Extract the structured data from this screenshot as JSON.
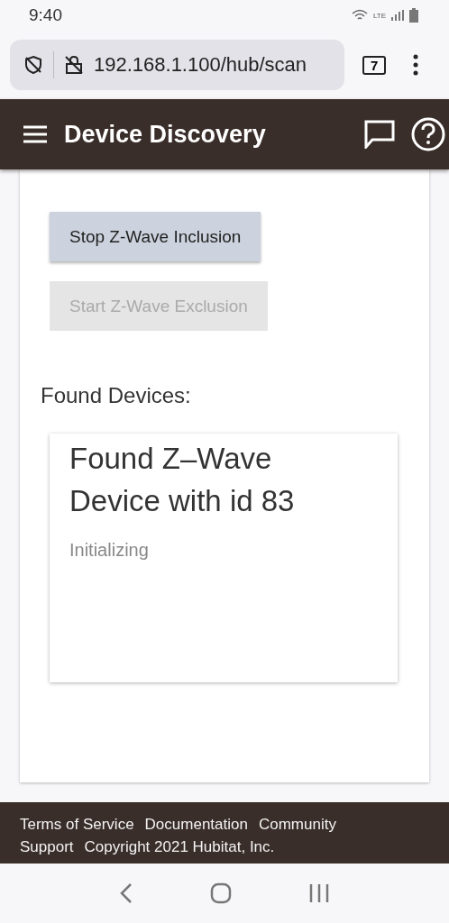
{
  "status_bar": {
    "time": "9:40",
    "network": "LTE"
  },
  "browser": {
    "url": "192.168.1.100/hub/scan",
    "tab_count": "7"
  },
  "app_bar": {
    "title": "Device Discovery"
  },
  "buttons": [
    {
      "label": "Stop Z-Wave Inclusion",
      "disabled": false
    },
    {
      "label": "Start Z-Wave Exclusion",
      "disabled": true
    }
  ],
  "found_heading": "Found Devices:",
  "devices": [
    {
      "title": "Found Z–Wave Device with id 83",
      "status": "Initializing"
    }
  ],
  "footer_links": [
    "Terms of Service",
    "Documentation",
    "Community",
    "Support",
    "Copyright 2021 Hubitat, Inc."
  ]
}
